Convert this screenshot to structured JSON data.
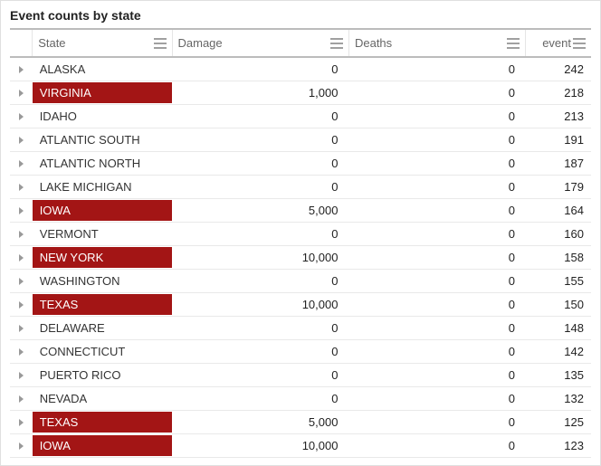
{
  "title": "Event counts by state",
  "columns": {
    "state": "State",
    "damage": "Damage",
    "deaths": "Deaths",
    "event": "event"
  },
  "rows": [
    {
      "state": "ALASKA",
      "damage": "0",
      "deaths": "0",
      "event": "242",
      "hl": false
    },
    {
      "state": "VIRGINIA",
      "damage": "1,000",
      "deaths": "0",
      "event": "218",
      "hl": true
    },
    {
      "state": "IDAHO",
      "damage": "0",
      "deaths": "0",
      "event": "213",
      "hl": false
    },
    {
      "state": "ATLANTIC SOUTH",
      "damage": "0",
      "deaths": "0",
      "event": "191",
      "hl": false
    },
    {
      "state": "ATLANTIC NORTH",
      "damage": "0",
      "deaths": "0",
      "event": "187",
      "hl": false
    },
    {
      "state": "LAKE MICHIGAN",
      "damage": "0",
      "deaths": "0",
      "event": "179",
      "hl": false
    },
    {
      "state": "IOWA",
      "damage": "5,000",
      "deaths": "0",
      "event": "164",
      "hl": true
    },
    {
      "state": "VERMONT",
      "damage": "0",
      "deaths": "0",
      "event": "160",
      "hl": false
    },
    {
      "state": "NEW YORK",
      "damage": "10,000",
      "deaths": "0",
      "event": "158",
      "hl": true
    },
    {
      "state": "WASHINGTON",
      "damage": "0",
      "deaths": "0",
      "event": "155",
      "hl": false
    },
    {
      "state": "TEXAS",
      "damage": "10,000",
      "deaths": "0",
      "event": "150",
      "hl": true
    },
    {
      "state": "DELAWARE",
      "damage": "0",
      "deaths": "0",
      "event": "148",
      "hl": false
    },
    {
      "state": "CONNECTICUT",
      "damage": "0",
      "deaths": "0",
      "event": "142",
      "hl": false
    },
    {
      "state": "PUERTO RICO",
      "damage": "0",
      "deaths": "0",
      "event": "135",
      "hl": false
    },
    {
      "state": "NEVADA",
      "damage": "0",
      "deaths": "0",
      "event": "132",
      "hl": false
    },
    {
      "state": "TEXAS",
      "damage": "5,000",
      "deaths": "0",
      "event": "125",
      "hl": true
    },
    {
      "state": "IOWA",
      "damage": "10,000",
      "deaths": "0",
      "event": "123",
      "hl": true
    }
  ]
}
